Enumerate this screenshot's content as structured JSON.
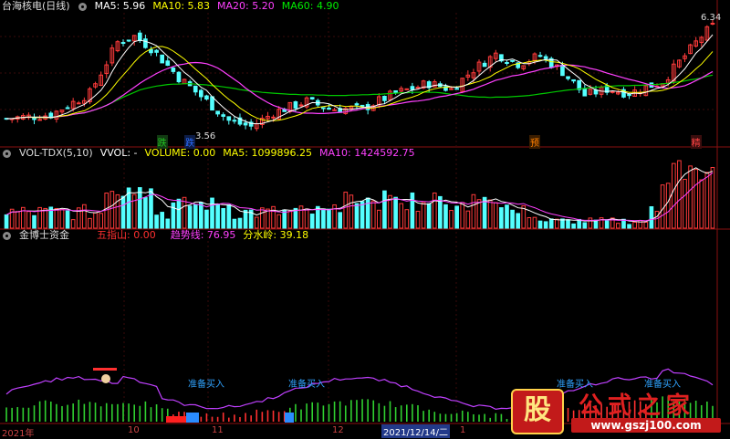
{
  "chart_data": [
    {
      "type": "candlestick",
      "title": "台海核电(日线)",
      "indicators": [
        {
          "label": "MA5: 5.96",
          "color": "#ffffff"
        },
        {
          "label": "MA10: 5.83",
          "color": "#ffff00"
        },
        {
          "label": "MA20: 5.20",
          "color": "#ff40ff"
        },
        {
          "label": "MA60: 4.90",
          "color": "#00e000"
        }
      ],
      "ylim": [
        3.3,
        6.6
      ],
      "annotations": {
        "high": "6.34",
        "low": "3.56"
      },
      "markers": [
        {
          "text": "跌",
          "index": 28,
          "color": "#22c422",
          "bg": "#123a12"
        },
        {
          "text": "跌",
          "index": 33,
          "color": "#2a6cff",
          "bg": "#0d1c44"
        },
        {
          "text": "预",
          "index": 95,
          "color": "#ff8000",
          "bg": "#3a1d00"
        },
        {
          "text": "精",
          "index": 124,
          "color": "#ff4444",
          "bg": "#3a0d0d"
        }
      ],
      "ohlc": [],
      "ma5": [],
      "ma10": [],
      "ma20": [],
      "ma60": []
    },
    {
      "type": "bar",
      "title": "VOL-TDX(5,10)",
      "indicators": [
        {
          "label": "VVOL: -",
          "color": "#ffffff"
        },
        {
          "label": "VOLUME: 0.00",
          "color": "#ffff00"
        },
        {
          "label": "MA5: 1099896.25",
          "color": "#ffff00"
        },
        {
          "label": "MA10: 1424592.75",
          "color": "#ff40ff"
        }
      ],
      "values": [],
      "ma5": [],
      "ma10": []
    },
    {
      "type": "bar",
      "title": "金博士资金",
      "indicators": [
        {
          "label": "五指山: 0.00",
          "color": "#ff3030"
        },
        {
          "label": "趋势线: 76.95",
          "color": "#ff40ff"
        },
        {
          "label": "分水岭: 39.18",
          "color": "#ffff00"
        }
      ],
      "annotations": [
        "准备买入",
        "准备买入",
        "准备买入",
        "准备买入"
      ],
      "trend": [],
      "bars": []
    }
  ],
  "x_axis": {
    "labels": [
      "2021年",
      "10",
      "11",
      "12",
      "1"
    ],
    "selected": "2021/12/14/二"
  },
  "watermark": {
    "badge": "股",
    "title": "公式之家",
    "url": "www.gszj100.com"
  }
}
